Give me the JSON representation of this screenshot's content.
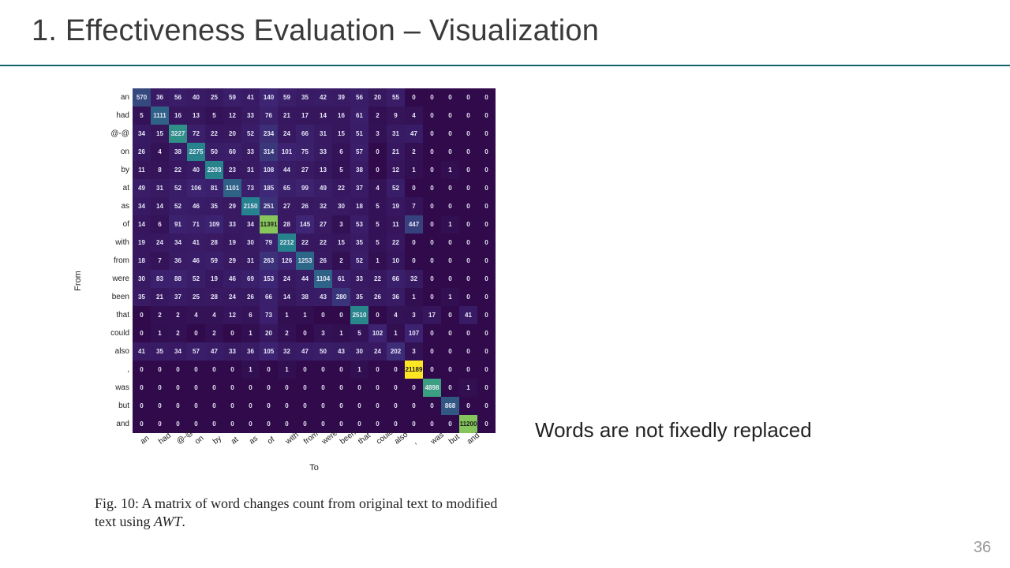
{
  "title": "1. Effectiveness Evaluation – Visualization",
  "note": "Words are not fixedly replaced",
  "page_number": "36",
  "figure": {
    "ylabel": "From",
    "xlabel": "To",
    "caption_prefix": "Fig. 10: A matrix of word changes count from original text to modified text using ",
    "caption_em": "AWT",
    "caption_suffix": "."
  },
  "chart_data": {
    "type": "heatmap",
    "row_labels": [
      "an",
      "had",
      "@-@",
      "on",
      "by",
      "at",
      "as",
      "of",
      "with",
      "from",
      "were",
      "been",
      "that",
      "could",
      "also",
      ",",
      "was",
      "but",
      "and"
    ],
    "col_labels": [
      "an",
      "had",
      "@-@",
      "on",
      "by",
      "at",
      "as",
      "of",
      "with",
      "from",
      "were",
      "been",
      "that",
      "could",
      "also",
      ",",
      "was",
      "but",
      "and",
      "_"
    ],
    "matrix": [
      [
        570,
        36,
        56,
        40,
        25,
        59,
        41,
        140,
        59,
        35,
        42,
        39,
        56,
        20,
        55,
        0,
        0,
        0,
        0,
        0
      ],
      [
        5,
        1111,
        16,
        13,
        5,
        12,
        33,
        76,
        21,
        17,
        14,
        16,
        61,
        2,
        9,
        4,
        0,
        0,
        0,
        0
      ],
      [
        34,
        15,
        3227,
        72,
        22,
        20,
        52,
        234,
        24,
        66,
        31,
        15,
        51,
        3,
        31,
        47,
        0,
        0,
        0,
        0
      ],
      [
        26,
        4,
        38,
        2275,
        50,
        60,
        33,
        314,
        101,
        75,
        33,
        6,
        57,
        0,
        21,
        2,
        0,
        0,
        0,
        0
      ],
      [
        11,
        8,
        22,
        40,
        2293,
        23,
        31,
        108,
        44,
        27,
        13,
        5,
        38,
        0,
        12,
        1,
        0,
        1,
        0,
        0
      ],
      [
        49,
        31,
        52,
        106,
        81,
        1101,
        73,
        185,
        65,
        99,
        49,
        22,
        37,
        4,
        52,
        0,
        0,
        0,
        0,
        0
      ],
      [
        34,
        14,
        52,
        46,
        35,
        29,
        2150,
        251,
        27,
        26,
        32,
        30,
        18,
        5,
        19,
        7,
        0,
        0,
        0,
        0
      ],
      [
        14,
        6,
        91,
        71,
        109,
        33,
        34,
        11391,
        28,
        145,
        27,
        3,
        53,
        5,
        11,
        447,
        0,
        1,
        0,
        0
      ],
      [
        19,
        24,
        34,
        41,
        28,
        19,
        30,
        79,
        2212,
        22,
        22,
        15,
        35,
        5,
        22,
        0,
        0,
        0,
        0,
        0
      ],
      [
        18,
        7,
        36,
        46,
        59,
        29,
        31,
        263,
        126,
        1253,
        26,
        2,
        52,
        1,
        10,
        0,
        0,
        0,
        0,
        0
      ],
      [
        30,
        83,
        88,
        52,
        19,
        46,
        69,
        153,
        24,
        44,
        1104,
        61,
        33,
        22,
        66,
        32,
        0,
        0,
        0,
        0
      ],
      [
        35,
        21,
        37,
        25,
        28,
        24,
        26,
        66,
        14,
        38,
        43,
        280,
        35,
        26,
        36,
        1,
        0,
        1,
        0,
        0
      ],
      [
        0,
        2,
        2,
        4,
        4,
        12,
        6,
        73,
        1,
        1,
        0,
        0,
        2510,
        0,
        4,
        3,
        17,
        0,
        41,
        0
      ],
      [
        0,
        1,
        2,
        0,
        2,
        0,
        1,
        20,
        2,
        0,
        3,
        1,
        5,
        102,
        1,
        107,
        0,
        0,
        0,
        0
      ],
      [
        41,
        35,
        34,
        57,
        47,
        33,
        36,
        105,
        32,
        47,
        50,
        43,
        30,
        24,
        202,
        3,
        0,
        0,
        0,
        0
      ],
      [
        0,
        0,
        0,
        0,
        0,
        0,
        1,
        0,
        1,
        0,
        0,
        0,
        1,
        0,
        0,
        21189,
        0,
        0,
        0,
        0
      ],
      [
        0,
        0,
        0,
        0,
        0,
        0,
        0,
        0,
        0,
        0,
        0,
        0,
        0,
        0,
        0,
        0,
        4898,
        0,
        1,
        0
      ],
      [
        0,
        0,
        0,
        0,
        0,
        0,
        0,
        0,
        0,
        0,
        0,
        0,
        0,
        0,
        0,
        0,
        0,
        868,
        0,
        0
      ],
      [
        0,
        0,
        0,
        0,
        0,
        0,
        0,
        0,
        0,
        0,
        0,
        0,
        0,
        0,
        0,
        0,
        0,
        0,
        11200,
        0
      ]
    ],
    "value_range": [
      0,
      21189
    ]
  }
}
